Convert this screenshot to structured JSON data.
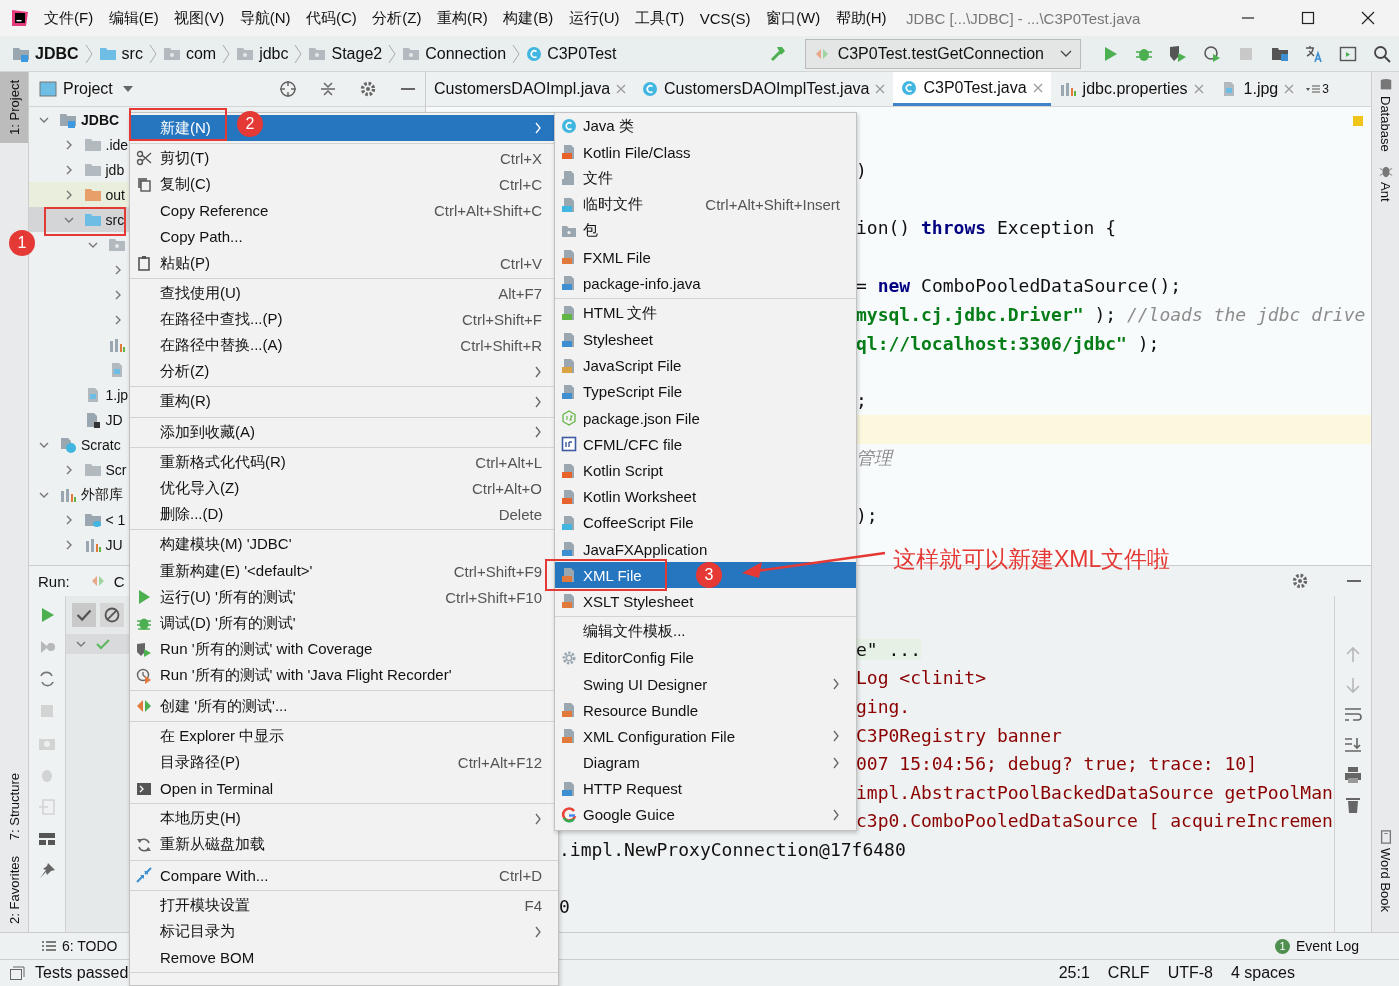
{
  "menu_bar": {
    "items": [
      "文件(F)",
      "编辑(E)",
      "视图(V)",
      "导航(N)",
      "代码(C)",
      "分析(Z)",
      "重构(R)",
      "构建(B)",
      "运行(U)",
      "工具(T)",
      "VCS(S)",
      "窗口(W)",
      "帮助(H)"
    ],
    "title": "JDBC [...\\JDBC] - ...\\C3P0Test.java"
  },
  "nav_bar": {
    "breadcrumbs": [
      {
        "label": "JDBC",
        "kind": "project"
      },
      {
        "label": "src",
        "kind": "source"
      },
      {
        "label": "com",
        "kind": "package"
      },
      {
        "label": "jdbc",
        "kind": "package"
      },
      {
        "label": "Stage2",
        "kind": "package"
      },
      {
        "label": "Connection",
        "kind": "package"
      },
      {
        "label": "C3P0Test",
        "kind": "class"
      }
    ],
    "run_config": "C3P0Test.testGetConnection"
  },
  "left_stripe": [
    {
      "label": "1: Project",
      "selected": true
    },
    {
      "label": "7: Structure",
      "selected": false
    },
    {
      "label": "2: Favorites",
      "selected": false
    }
  ],
  "right_stripe": [
    "Database",
    "Ant",
    "Word Book"
  ],
  "project_panel": {
    "title": "Project",
    "tree": [
      {
        "label": "JDBC",
        "kind": "project",
        "expanded": true,
        "selected": false,
        "children": [
          {
            "label": ".ide",
            "kind": "folder",
            "expanded": false,
            "selected": false
          },
          {
            "label": "jdb",
            "kind": "folder",
            "expanded": false,
            "selected": false
          },
          {
            "label": "out",
            "kind": "excluded",
            "expanded": false,
            "selected": false
          },
          {
            "label": "src",
            "kind": "source",
            "expanded": true,
            "selected": true,
            "children": [
              {
                "kind": "package",
                "expanded": true,
                "selected": false,
                "children": [
                  {
                    "expanded": false,
                    "selected": false
                  },
                  {
                    "expanded": false,
                    "selected": false
                  },
                  {
                    "expanded": false,
                    "selected": false
                  }
                ]
              },
              {
                "kind": "bundle",
                "selected": false
              },
              {
                "kind": "image",
                "selected": false
              }
            ]
          },
          {
            "label": "1.jp",
            "kind": "image",
            "selected": false
          },
          {
            "label": "JD",
            "kind": "module",
            "selected": false
          }
        ]
      },
      {
        "label": "Scratc",
        "kind": "scratch",
        "expanded": true,
        "selected": false,
        "children": [
          {
            "label": "Scr",
            "kind": "folder",
            "expanded": false,
            "selected": false
          }
        ]
      },
      {
        "label": "外部库",
        "kind": "library",
        "expanded": true,
        "selected": false,
        "children": [
          {
            "label": "< 1",
            "kind": "jdk",
            "expanded": false,
            "selected": false
          },
          {
            "label": "JU",
            "kind": "library",
            "expanded": false,
            "selected": false
          }
        ]
      }
    ]
  },
  "editor_tabs": {
    "tabs": [
      {
        "label": "CustomersDAOImpl.java",
        "selected": false
      },
      {
        "label": "CustomersDAOImplTest.java",
        "selected": false
      },
      {
        "label": "C3P0Test.java",
        "selected": true
      },
      {
        "label": "jdbc.properties",
        "selected": false
      },
      {
        "label": "1.jpg",
        "selected": false
      }
    ],
    "overflow_count": "3"
  },
  "editor": {
    "lines": [
      {
        "current": false,
        "segments": [
          {
            "text": ")",
            "kind": "plain"
          }
        ]
      },
      {
        "current": false
      },
      {
        "current": false,
        "segments": [
          {
            "text": "ion() ",
            "kind": "plain"
          },
          {
            "text": "throws",
            "kind": "keyword"
          },
          {
            "text": " Exception {",
            "kind": "plain"
          }
        ]
      },
      {
        "current": false
      },
      {
        "current": false,
        "segments": [
          {
            "text": "= ",
            "kind": "plain"
          },
          {
            "text": "new",
            "kind": "keyword"
          },
          {
            "text": " ComboPooledDataSource();",
            "kind": "plain"
          }
        ]
      },
      {
        "current": false,
        "segments": [
          {
            "text": "mysql.cj.jdbc.Driver\"",
            "kind": "string"
          },
          {
            "text": " ); ",
            "kind": "plain"
          },
          {
            "text": "//loads the jdbc drive",
            "kind": "comment"
          }
        ]
      },
      {
        "current": false,
        "segments": [
          {
            "text": "ql://localhost:3306/jdbc\"",
            "kind": "string"
          },
          {
            "text": " );",
            "kind": "plain"
          }
        ]
      },
      {
        "current": false
      },
      {
        "current": false,
        "segments": [
          {
            "text": ";",
            "kind": "plain"
          }
        ]
      },
      {
        "current": true
      },
      {
        "current": false,
        "segments": [
          {
            "text": "管理",
            "kind": "comment"
          }
        ]
      },
      {
        "current": false
      },
      {
        "current": false,
        "segments": [
          {
            "text": ");",
            "kind": "plain"
          }
        ]
      }
    ]
  },
  "run_panel": {
    "title": "Run:",
    "tab": "C",
    "console": [
      {
        "text": "e\" ...",
        "kind": "info"
      },
      {
        "text": "Log <clinit>",
        "kind": "stderr"
      },
      {
        "text": "ging.",
        "kind": "stderr"
      },
      {
        "text": "C3P0Registry banner",
        "kind": "stderr"
      },
      {
        "text": "007 15:04:56; debug? true; trace: 10]",
        "kind": "stderr"
      },
      {
        "text": "impl.AbstractPoolBackedDataSource getPoolMan",
        "kind": "stderr"
      },
      {
        "text": "c3p0.ComboPooledDataSource [ acquireIncremen",
        "kind": "stderr"
      },
      {
        "text": ".impl.NewProxyConnection@17f6480",
        "kind": "stdout"
      },
      {
        "kind": "blank"
      },
      {
        "text": "0",
        "kind": "stdout"
      }
    ]
  },
  "tool_window_bar": {
    "todo": "6: TODO",
    "event_log": "Event Log",
    "event_count": "1"
  },
  "status_bar": {
    "message": "Tests passed",
    "items": [
      "25:1",
      "CRLF",
      "UTF-8",
      "4 spaces"
    ]
  },
  "context_menu": {
    "items": [
      {
        "kind": "item",
        "label": "新建(N)",
        "selected": true,
        "submenu": true
      },
      {
        "kind": "separator"
      },
      {
        "kind": "item",
        "label": "剪切(T)",
        "shortcut": "Ctrl+X",
        "selected": false,
        "submenu": false
      },
      {
        "kind": "item",
        "label": "复制(C)",
        "shortcut": "Ctrl+C",
        "selected": false,
        "submenu": false
      },
      {
        "kind": "item",
        "label": "Copy Reference",
        "shortcut": "Ctrl+Alt+Shift+C",
        "selected": false,
        "submenu": false
      },
      {
        "kind": "item",
        "label": "Copy Path...",
        "selected": false,
        "submenu": false
      },
      {
        "kind": "item",
        "label": "粘贴(P)",
        "shortcut": "Ctrl+V",
        "selected": false,
        "submenu": false
      },
      {
        "kind": "separator"
      },
      {
        "kind": "item",
        "label": "查找使用(U)",
        "shortcut": "Alt+F7",
        "selected": false,
        "submenu": false
      },
      {
        "kind": "item",
        "label": "在路径中查找...(P)",
        "shortcut": "Ctrl+Shift+F",
        "selected": false,
        "submenu": false
      },
      {
        "kind": "item",
        "label": "在路径中替换...(A)",
        "shortcut": "Ctrl+Shift+R",
        "selected": false,
        "submenu": false
      },
      {
        "kind": "item",
        "label": "分析(Z)",
        "selected": false,
        "submenu": true
      },
      {
        "kind": "separator"
      },
      {
        "kind": "item",
        "label": "重构(R)",
        "selected": false,
        "submenu": true
      },
      {
        "kind": "separator"
      },
      {
        "kind": "item",
        "label": "添加到收藏(A)",
        "selected": false,
        "submenu": true
      },
      {
        "kind": "separator"
      },
      {
        "kind": "item",
        "label": "重新格式化代码(R)",
        "shortcut": "Ctrl+Alt+L",
        "selected": false,
        "submenu": false
      },
      {
        "kind": "item",
        "label": "优化导入(Z)",
        "shortcut": "Ctrl+Alt+O",
        "selected": false,
        "submenu": false
      },
      {
        "kind": "item",
        "label": "删除...(D)",
        "shortcut": "Delete",
        "selected": false,
        "submenu": false
      },
      {
        "kind": "separator"
      },
      {
        "kind": "item",
        "label": "构建模块(M) 'JDBC'",
        "selected": false,
        "submenu": false
      },
      {
        "kind": "item",
        "label": "重新构建(E) '<default>'",
        "shortcut": "Ctrl+Shift+F9",
        "selected": false,
        "submenu": false
      },
      {
        "kind": "item",
        "label": "运行(U) '所有的测试'",
        "shortcut": "Ctrl+Shift+F10",
        "selected": false,
        "submenu": false
      },
      {
        "kind": "item",
        "label": "调试(D) '所有的测试'",
        "selected": false,
        "submenu": false
      },
      {
        "kind": "item",
        "label": "Run '所有的测试' with Coverage",
        "selected": false,
        "submenu": false
      },
      {
        "kind": "item",
        "label": "Run '所有的测试' with 'Java Flight Recorder'",
        "selected": false,
        "submenu": false
      },
      {
        "kind": "separator"
      },
      {
        "kind": "item",
        "label": "创建 '所有的测试'...",
        "selected": false,
        "submenu": false
      },
      {
        "kind": "separator"
      },
      {
        "kind": "item",
        "label": "在 Explorer 中显示",
        "selected": false,
        "submenu": false
      },
      {
        "kind": "item",
        "label": "目录路径(P)",
        "shortcut": "Ctrl+Alt+F12",
        "selected": false,
        "submenu": false
      },
      {
        "kind": "item",
        "label": "Open in Terminal",
        "selected": false,
        "submenu": false
      },
      {
        "kind": "separator"
      },
      {
        "kind": "item",
        "label": "本地历史(H)",
        "selected": false,
        "submenu": true
      },
      {
        "kind": "item",
        "label": "重新从磁盘加载",
        "selected": false,
        "submenu": false
      },
      {
        "kind": "separator"
      },
      {
        "kind": "item",
        "label": "Compare With...",
        "shortcut": "Ctrl+D",
        "selected": false,
        "submenu": false
      },
      {
        "kind": "separator"
      },
      {
        "kind": "item",
        "label": "打开模块设置",
        "shortcut": "F4",
        "selected": false,
        "submenu": false
      },
      {
        "kind": "item",
        "label": "标记目录为",
        "selected": false,
        "submenu": true
      },
      {
        "kind": "item",
        "label": "Remove BOM",
        "selected": false,
        "submenu": false
      },
      {
        "kind": "separator"
      }
    ]
  },
  "new_submenu": {
    "items": [
      {
        "kind": "item",
        "label": "Java 类",
        "selected": false,
        "submenu": false
      },
      {
        "kind": "item",
        "label": "Kotlin File/Class",
        "selected": false,
        "submenu": false
      },
      {
        "kind": "item",
        "label": "文件",
        "selected": false,
        "submenu": false
      },
      {
        "kind": "item",
        "label": "临时文件",
        "shortcut": "Ctrl+Alt+Shift+Insert",
        "selected": false,
        "submenu": false
      },
      {
        "kind": "item",
        "label": "包",
        "selected": false,
        "submenu": false
      },
      {
        "kind": "item",
        "label": "FXML File",
        "selected": false,
        "submenu": false
      },
      {
        "kind": "item",
        "label": "package-info.java",
        "selected": false,
        "submenu": false
      },
      {
        "kind": "separator"
      },
      {
        "kind": "item",
        "label": "HTML 文件",
        "selected": false,
        "submenu": false
      },
      {
        "kind": "item",
        "label": "Stylesheet",
        "selected": false,
        "submenu": false
      },
      {
        "kind": "item",
        "label": "JavaScript File",
        "selected": false,
        "submenu": false
      },
      {
        "kind": "item",
        "label": "TypeScript File",
        "selected": false,
        "submenu": false
      },
      {
        "kind": "item",
        "label": "package.json File",
        "selected": false,
        "submenu": false
      },
      {
        "kind": "item",
        "label": "CFML/CFC file",
        "selected": false,
        "submenu": false
      },
      {
        "kind": "item",
        "label": "Kotlin Script",
        "selected": false,
        "submenu": false
      },
      {
        "kind": "item",
        "label": "Kotlin Worksheet",
        "selected": false,
        "submenu": false
      },
      {
        "kind": "item",
        "label": "CoffeeScript File",
        "selected": false,
        "submenu": false
      },
      {
        "kind": "item",
        "label": "JavaFXApplication",
        "selected": false,
        "submenu": false
      },
      {
        "kind": "item",
        "label": "XML File",
        "selected": true,
        "submenu": false
      },
      {
        "kind": "item",
        "label": "XSLT Stylesheet",
        "selected": false,
        "submenu": false
      },
      {
        "kind": "separator"
      },
      {
        "kind": "item",
        "label": "编辑文件模板...",
        "selected": false,
        "submenu": false
      },
      {
        "kind": "item",
        "label": "EditorConfig File",
        "selected": false,
        "submenu": false
      },
      {
        "kind": "item",
        "label": "Swing UI Designer",
        "selected": false,
        "submenu": true
      },
      {
        "kind": "item",
        "label": "Resource Bundle",
        "selected": false,
        "submenu": false
      },
      {
        "kind": "item",
        "label": "XML Configuration File",
        "selected": false,
        "submenu": true
      },
      {
        "kind": "item",
        "label": "Diagram",
        "selected": false,
        "submenu": true
      },
      {
        "kind": "item",
        "label": "HTTP Request",
        "selected": false,
        "submenu": false
      },
      {
        "kind": "item",
        "label": "Google Guice",
        "selected": false,
        "submenu": true
      }
    ]
  },
  "annotations": {
    "badges": [
      "1",
      "2",
      "3"
    ],
    "callout": "这样就可以新建XML文件啦"
  }
}
